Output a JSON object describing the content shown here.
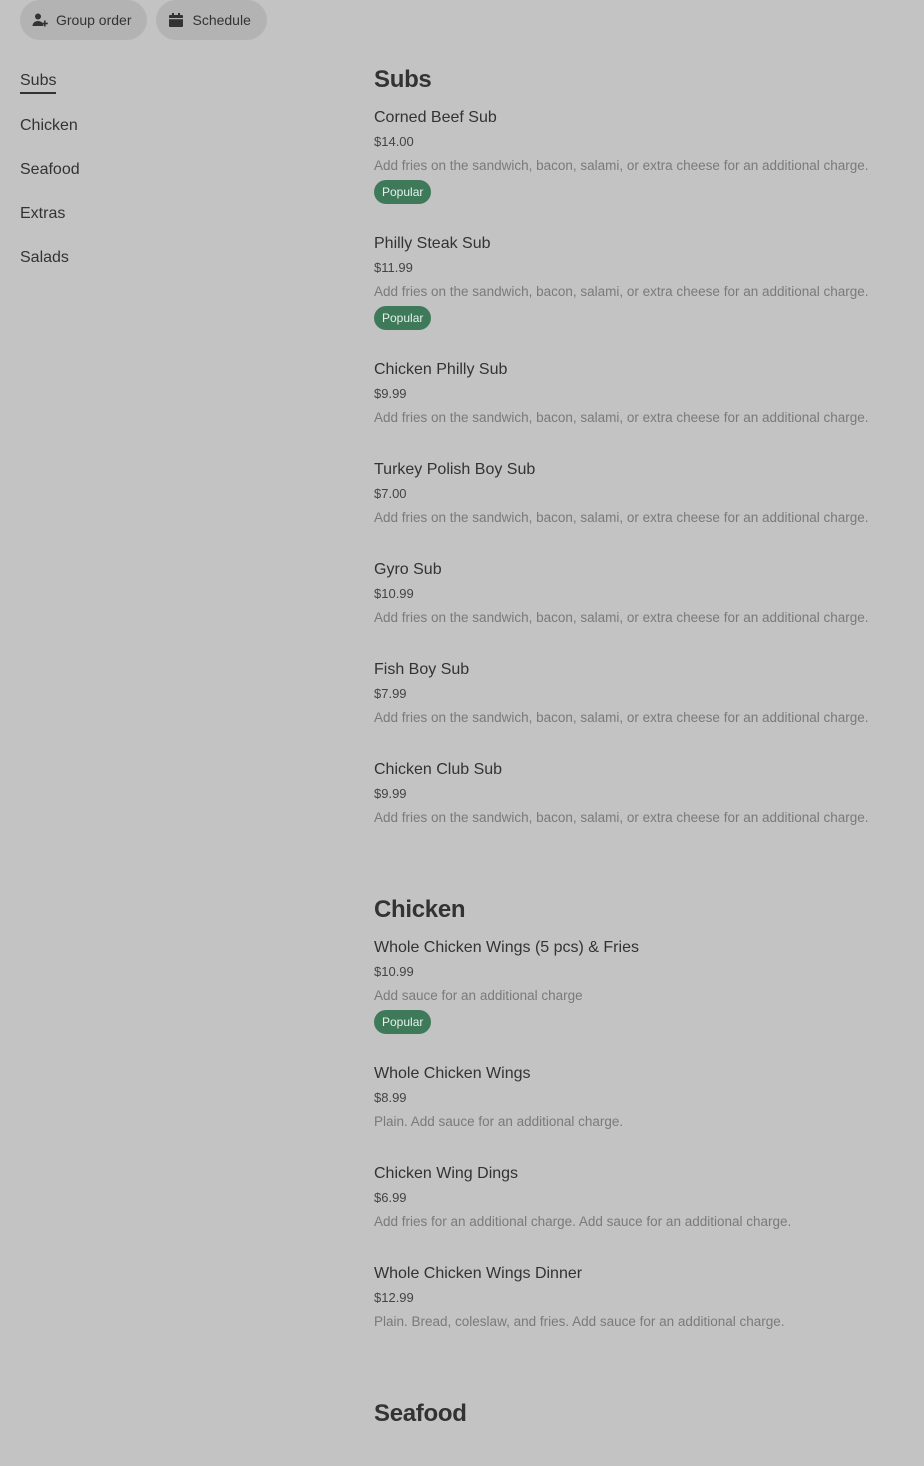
{
  "toolbar": {
    "group_order_label": "Group order",
    "schedule_label": "Schedule"
  },
  "nav": [
    "Subs",
    "Chicken",
    "Seafood",
    "Extras",
    "Salads"
  ],
  "active_nav": "Subs",
  "sections": [
    {
      "title": "Subs",
      "items": [
        {
          "name": "Corned Beef Sub",
          "price": "$14.00",
          "desc": "Add fries on the sandwich, bacon, salami, or extra cheese for an additional charge.",
          "badge": "Popular"
        },
        {
          "name": "Philly Steak Sub",
          "price": "$11.99",
          "desc": "Add fries on the sandwich, bacon, salami, or extra cheese for an additional charge.",
          "badge": "Popular"
        },
        {
          "name": "Chicken Philly Sub",
          "price": "$9.99",
          "desc": "Add fries on the sandwich, bacon, salami, or extra cheese for an additional charge."
        },
        {
          "name": "Turkey Polish Boy Sub",
          "price": "$7.00",
          "desc": "Add fries on the sandwich, bacon, salami, or extra cheese for an additional charge."
        },
        {
          "name": "Gyro Sub",
          "price": "$10.99",
          "desc": "Add fries on the sandwich, bacon, salami, or extra cheese for an additional charge."
        },
        {
          "name": "Fish Boy Sub",
          "price": "$7.99",
          "desc": "Add fries on the sandwich, bacon, salami, or extra cheese for an additional charge."
        },
        {
          "name": "Chicken Club Sub",
          "price": "$9.99",
          "desc": "Add fries on the sandwich, bacon, salami, or extra cheese for an additional charge."
        }
      ]
    },
    {
      "title": "Chicken",
      "items": [
        {
          "name": "Whole Chicken Wings (5 pcs) & Fries",
          "price": "$10.99",
          "desc": "Add sauce for an additional charge",
          "badge": "Popular"
        },
        {
          "name": "Whole Chicken Wings",
          "price": "$8.99",
          "desc": "Plain. Add sauce for an additional charge."
        },
        {
          "name": "Chicken Wing Dings",
          "price": "$6.99",
          "desc": "Add fries for an additional charge. Add sauce for an additional charge."
        },
        {
          "name": "Whole Chicken Wings Dinner",
          "price": "$12.99",
          "desc": "Plain. Bread, coleslaw, and fries. Add sauce for an additional charge."
        }
      ]
    },
    {
      "title": "Seafood",
      "items": []
    }
  ]
}
